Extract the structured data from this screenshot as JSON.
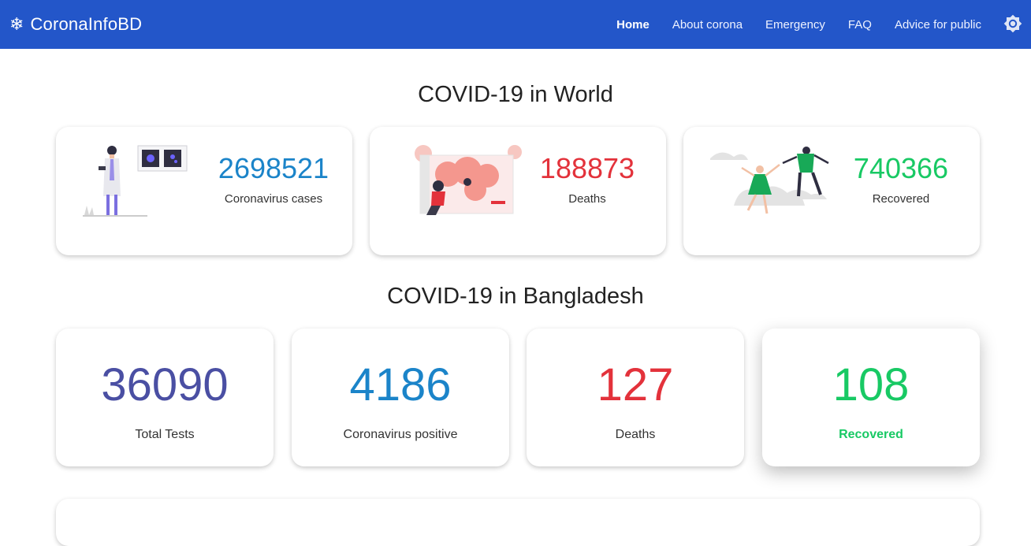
{
  "brand": {
    "icon": "❄",
    "name": "CoronaInfoBD"
  },
  "nav": {
    "items": [
      {
        "label": "Home",
        "active": true
      },
      {
        "label": "About corona",
        "active": false
      },
      {
        "label": "Emergency",
        "active": false
      },
      {
        "label": "FAQ",
        "active": false
      },
      {
        "label": "Advice for public",
        "active": false
      }
    ],
    "theme_icon": "brightness-icon"
  },
  "world": {
    "title": "COVID-19 in World",
    "cards": [
      {
        "value": "2698521",
        "label": "Coronavirus cases",
        "color": "#1b84c9",
        "illustration": "doctor-illustration"
      },
      {
        "value": "188873",
        "label": "Deaths",
        "color": "#e3323b",
        "illustration": "sick-person-illustration"
      },
      {
        "value": "740366",
        "label": "Recovered",
        "color": "#18c964",
        "illustration": "celebrating-people-illustration"
      }
    ]
  },
  "bangladesh": {
    "title": "COVID-19 in Bangladesh",
    "cards": [
      {
        "value": "36090",
        "label": "Total Tests",
        "color": "#4a4fa3"
      },
      {
        "value": "4186",
        "label": "Coronavirus positive",
        "color": "#1b84c9"
      },
      {
        "value": "127",
        "label": "Deaths",
        "color": "#e3323b"
      },
      {
        "value": "108",
        "label": "Recovered",
        "color": "#18c964"
      }
    ]
  },
  "colors": {
    "navbar": "#2356c9",
    "brand_text": "#ffffff"
  }
}
